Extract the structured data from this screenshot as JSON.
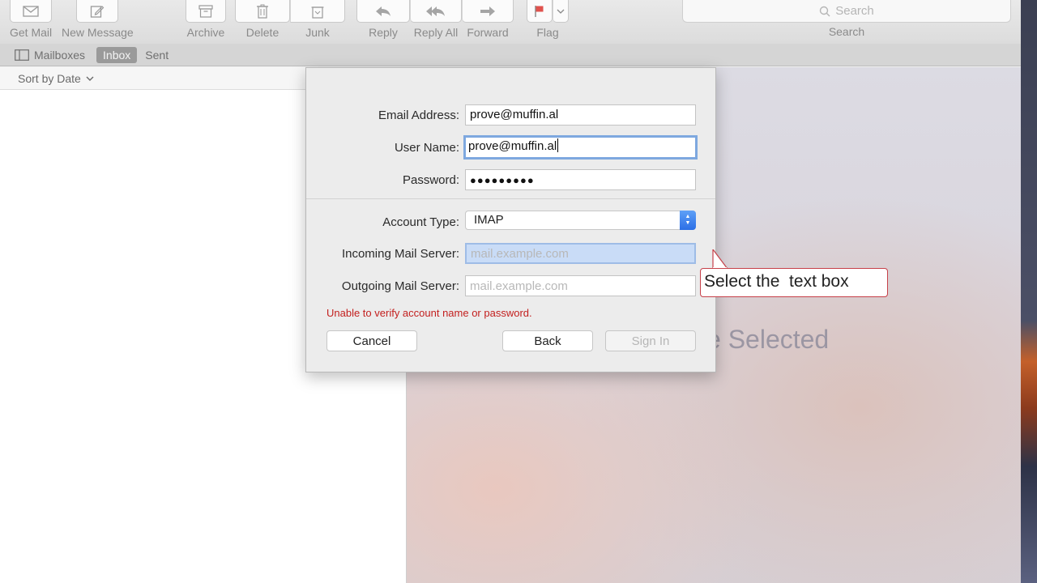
{
  "toolbar": {
    "get_mail": "Get Mail",
    "new_message": "New Message",
    "archive": "Archive",
    "delete": "Delete",
    "junk": "Junk",
    "reply": "Reply",
    "reply_all": "Reply All",
    "forward": "Forward",
    "flag": "Flag",
    "search_placeholder": "Search",
    "search_label": "Search"
  },
  "favorites": {
    "mailboxes": "Mailboxes",
    "inbox": "Inbox",
    "sent": "Sent"
  },
  "list": {
    "sort_label": "Sort by Date"
  },
  "viewer": {
    "no_message_text": "e Selected"
  },
  "dialog": {
    "email_label": "Email Address:",
    "email_value": "prove@muffin.al",
    "username_label": "User Name:",
    "username_value": "prove@muffin.al",
    "password_label": "Password:",
    "password_value": "●●●●●●●●●",
    "account_type_label": "Account Type:",
    "account_type_value": "IMAP",
    "incoming_label": "Incoming Mail Server:",
    "incoming_placeholder": "mail.example.com",
    "outgoing_label": "Outgoing Mail Server:",
    "outgoing_placeholder": "mail.example.com",
    "error_text": "Unable to verify account name or password.",
    "cancel": "Cancel",
    "back": "Back",
    "sign_in": "Sign In"
  },
  "callout": {
    "text": "Select the  text box",
    "border_color": "#c64049"
  },
  "colors": {
    "error": "#c3201f",
    "focus_ring": "#7ea8df",
    "flag": "#e0524d"
  }
}
